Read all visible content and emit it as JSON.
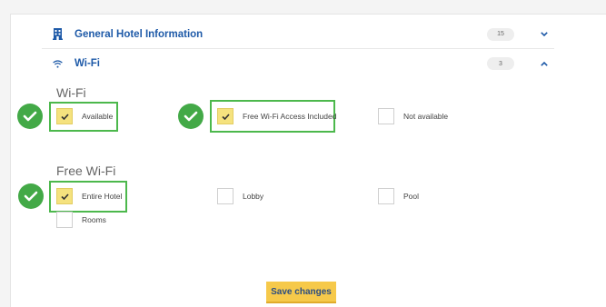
{
  "accordion": [
    {
      "icon": "building-icon",
      "title": "General Hotel Information",
      "count": "15",
      "expanded": false
    },
    {
      "icon": "wifi-icon",
      "title": "Wi-Fi",
      "count": "3",
      "expanded": true
    }
  ],
  "wifi_section": {
    "title": "Wi-Fi",
    "options": [
      {
        "label": "Available",
        "checked": true,
        "highlighted": true
      },
      {
        "label": "Free Wi-Fi Access Included",
        "checked": true,
        "highlighted": true
      },
      {
        "label": "Not available",
        "checked": false,
        "highlighted": false
      }
    ]
  },
  "free_wifi_section": {
    "title": "Free Wi-Fi",
    "options": [
      {
        "label": "Entire Hotel",
        "checked": true,
        "highlighted": true
      },
      {
        "label": "Lobby",
        "checked": false,
        "highlighted": false
      },
      {
        "label": "Pool",
        "checked": false,
        "highlighted": false
      },
      {
        "label": "Rooms",
        "checked": false,
        "highlighted": false
      }
    ]
  },
  "save_button": {
    "label": "Save changes"
  },
  "colors": {
    "accent_blue": "#1e5aa8",
    "check_fill": "#f5e27e",
    "highlight_green": "#4cb84c",
    "badge_green": "#43a947",
    "button_yellow": "#f6c94a"
  }
}
